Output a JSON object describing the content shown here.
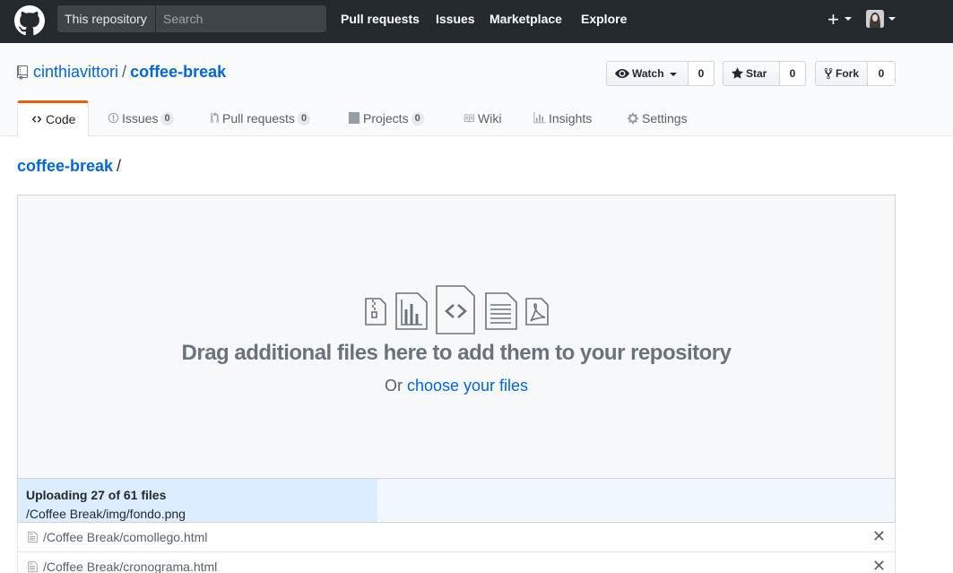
{
  "header": {
    "scope_label": "This repository",
    "search_placeholder": "Search",
    "nav": [
      "Pull requests",
      "Issues",
      "Marketplace",
      "Explore"
    ],
    "plus_label": "+"
  },
  "repo": {
    "owner": "cinthiavittori",
    "separator": "/",
    "name": "coffee-break",
    "actions": {
      "watch_label": "Watch",
      "watch_count": "0",
      "star_label": "Star",
      "star_count": "0",
      "fork_label": "Fork",
      "fork_count": "0"
    },
    "tabs": [
      {
        "label": "Code",
        "icon": "code-icon",
        "selected": true
      },
      {
        "label": "Issues",
        "icon": "issue-icon",
        "counter": "0"
      },
      {
        "label": "Pull requests",
        "icon": "pull-request-icon",
        "counter": "0"
      },
      {
        "label": "Projects",
        "icon": "project-icon",
        "counter": "0"
      },
      {
        "label": "Wiki",
        "icon": "book-icon"
      },
      {
        "label": "Insights",
        "icon": "graph-icon"
      },
      {
        "label": "Settings",
        "icon": "gear-icon"
      }
    ]
  },
  "breadcrumb": {
    "repo_link": "coffee-break",
    "slash": "/"
  },
  "dropzone": {
    "title": "Drag additional files here to add them to your repository",
    "or_text": "Or",
    "choose_link": "choose your files",
    "icons": [
      "file-zip-icon",
      "graph-file-icon",
      "file-code-icon",
      "file-text-icon",
      "file-pdf-icon"
    ]
  },
  "upload": {
    "status": "Uploading 27 of 61 files",
    "current_file": "/Coffee Break/img/fondo.png",
    "progress_fraction": 0.41,
    "files": [
      {
        "name": "/Coffee Break/comollego.html"
      },
      {
        "name": "/Coffee Break/cronograma.html"
      }
    ]
  }
}
